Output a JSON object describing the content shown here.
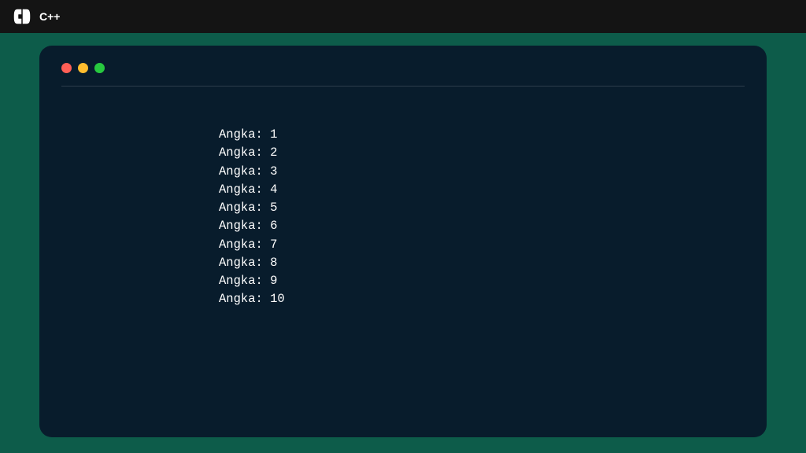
{
  "header": {
    "title": "C++"
  },
  "terminal": {
    "output_prefix": "Angka: ",
    "lines": [
      "Angka: 1",
      "Angka: 2",
      "Angka: 3",
      "Angka: 4",
      "Angka: 5",
      "Angka: 6",
      "Angka: 7",
      "Angka: 8",
      "Angka: 9",
      "Angka: 10"
    ]
  }
}
